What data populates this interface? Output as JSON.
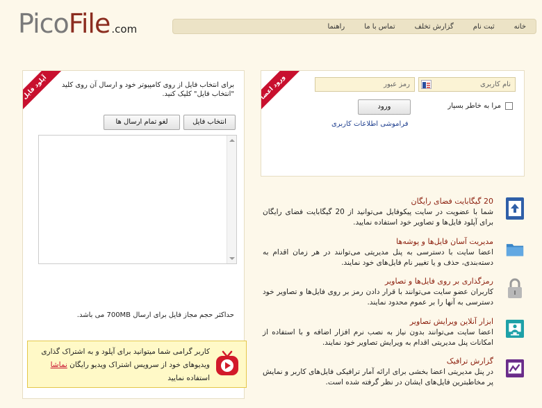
{
  "logo": {
    "pico": "Pico",
    "file": "File",
    "com": ".com"
  },
  "nav": {
    "items": [
      "خانه",
      "ثبت نام",
      "گزارش تخلف",
      "تماس با ما",
      "راهنما"
    ]
  },
  "login": {
    "ribbon": "ورود اعضا",
    "username_placeholder": "نام کاربری",
    "password_placeholder": "رمز عبور",
    "submit_label": "ورود",
    "remember_label": "مرا به خاطر بسپار",
    "forgot_label": "فراموشی اطلاعات کاربری"
  },
  "upload": {
    "ribbon": "آپلود فایل",
    "instructions": "برای انتخاب فایل از روی کامپیوتر خود و ارسال آن روی کلید \"انتخاب فایل\" کلیک کنید.",
    "choose_label": "انتخاب فایل",
    "cancel_label": "لغو تمام ارسال ها",
    "max_size": "حداکثر حجم مجاز فایل برای ارسال 700MB می باشد.",
    "promo_before": "کاربر گرامی شما میتوانید برای آپلود و به اشتراک گذاری ویدیوهای خود از سرویس اشتراک ویدیو رایگان ",
    "promo_link": "نماشا",
    "promo_after": " استفاده نمایید"
  },
  "features": [
    {
      "icon": "upload-arrow-icon",
      "title": "20 گیگابایت فضای رایگان",
      "desc": "شما با عضویت در سایت پیکوفایل می‌توانید از 20 گیگابایت فضای رایگان برای آپلود فایل‌ها و تصاویر خود استفاده نمایید."
    },
    {
      "icon": "folder-icon",
      "title": "مدیریت آسان فایل‌ها و پوشه‌ها",
      "desc": "اعضا سایت با دسترسی به پنل مدیریتی می‌توانند در هر زمان اقدام به دسته‌بندی، حذف و یا تغییر نام فایل‌های خود نمایند."
    },
    {
      "icon": "lock-icon",
      "title": "رمزگذاری بر روی فایل‌ها و تصاویر",
      "desc": "کاربران عضو سایت می‌توانند با قرار دادن رمز بر روی فایل‌ها و تصاویر خود دسترسی به آنها را بر عموم محدود نمایند."
    },
    {
      "icon": "image-editor-icon",
      "title": "ابزار آنلاین ویرایش تصاویر",
      "desc": "اعضا سایت می‌توانند بدون نیاز به نصب نرم افزار اضافه و با استفاده از امکانات پنل مدیریتی اقدام به ویرایش تصاویر خود نمایند."
    },
    {
      "icon": "chart-icon",
      "title": "گزارش ترافیک",
      "desc": "در پنل مدیریتی اعضا بخشی برای ارائه آمار ترافیکی فایل‌های کاربر و نمایش پر مخاطبترین فایل‌های ایشان در نظر گرفته شده است."
    }
  ]
}
